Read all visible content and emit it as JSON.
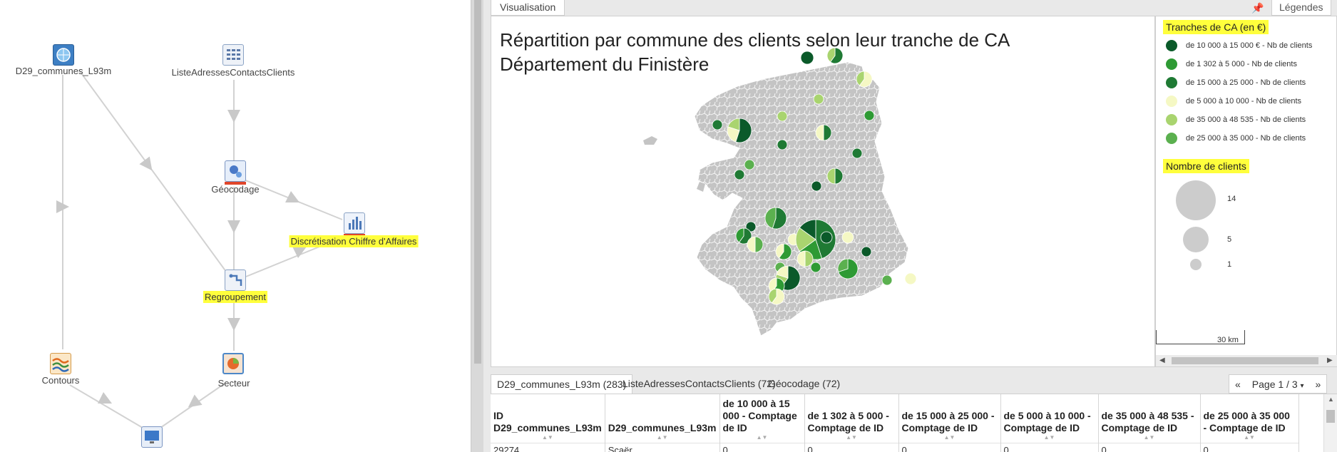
{
  "workflow": {
    "nodes": [
      {
        "id": "d29",
        "label": "D29_communes_L93m",
        "icon": "globe-layer-icon",
        "highlight": false
      },
      {
        "id": "liste",
        "label": "ListeAdressesContactsClients",
        "icon": "table-icon",
        "highlight": false
      },
      {
        "id": "geocodage",
        "label": "Géocodage",
        "icon": "geocode-icon",
        "highlight": false
      },
      {
        "id": "discret",
        "label": "Discrétisation Chiffre d'Affaires",
        "icon": "bar-chart-icon",
        "highlight": true
      },
      {
        "id": "regroup",
        "label": "Regroupement",
        "icon": "group-icon",
        "highlight": true
      },
      {
        "id": "contours",
        "label": "Contours",
        "icon": "contours-icon",
        "highlight": false
      },
      {
        "id": "secteur",
        "label": "Secteur",
        "icon": "pie-sector-icon",
        "highlight": false
      },
      {
        "id": "visual",
        "label": "",
        "icon": "monitor-icon",
        "highlight": false
      }
    ]
  },
  "visualisation": {
    "tab_label": "Visualisation",
    "legend_tab_label": "Légendes",
    "pin_icon": "pin-icon",
    "map_title_line1": "Répartition par commune des clients selon leur tranche de CA",
    "map_title_line2": "Département du Finistère",
    "colors": {
      "dark_green": "#0b5a2a",
      "green": "#2e9a34",
      "mid_green": "#1f7a34",
      "pale_yellow": "#f5f8c4",
      "light_green": "#a9d46f",
      "soft_green": "#5bb04f",
      "commune_grey": "#c4c4c4",
      "highlight_yellow": "#ffff3c"
    }
  },
  "legend": {
    "ca_heading": "Tranches de CA (en €)",
    "ca_items": [
      {
        "label": "de 10 000 à 15 000 € - Nb de clients",
        "color": "#0b5a2a"
      },
      {
        "label": "de 1 302 à 5 000 - Nb de clients",
        "color": "#2e9a34"
      },
      {
        "label": "de 15 000 à 25 000 - Nb de clients",
        "color": "#1f7a34"
      },
      {
        "label": "de 5 000 à 10 000 - Nb de clients",
        "color": "#f5f8c4"
      },
      {
        "label": "de 35 000 à 48 535 - Nb de clients",
        "color": "#a9d46f"
      },
      {
        "label": "de 25 000 à 35 000 - Nb de clients",
        "color": "#5bb04f"
      }
    ],
    "size_heading": "Nombre de clients",
    "size_items": [
      {
        "label": "14",
        "value": 14
      },
      {
        "label": "5",
        "value": 5
      },
      {
        "label": "1",
        "value": 1
      }
    ],
    "scale_label": "30 km"
  },
  "table": {
    "tabs": [
      {
        "label": "D29_communes_L93m (283)",
        "active": true
      },
      {
        "label": "ListeAdressesContactsClients (72)",
        "active": false
      },
      {
        "label": "Géocodage (72)",
        "active": false
      }
    ],
    "pager": {
      "prev": "«",
      "page": "Page 1 / 3",
      "next": "»"
    },
    "columns": [
      "ID D29_communes_L93m",
      "D29_communes_L93m",
      "de 10 000 à 15 000 - Comptage de ID",
      "de 1 302 à 5 000 - Comptage de ID",
      "de 15 000 à 25 000 - Comptage de ID",
      "de 5 000 à 10 000 - Comptage de ID",
      "de 35 000 à 48 535 - Comptage de ID",
      "de 25 000 à 35 000 - Comptage de ID"
    ],
    "rows": [
      [
        "29274",
        "Scaër",
        "0",
        "0",
        "0",
        "0",
        "0",
        "0"
      ]
    ]
  }
}
